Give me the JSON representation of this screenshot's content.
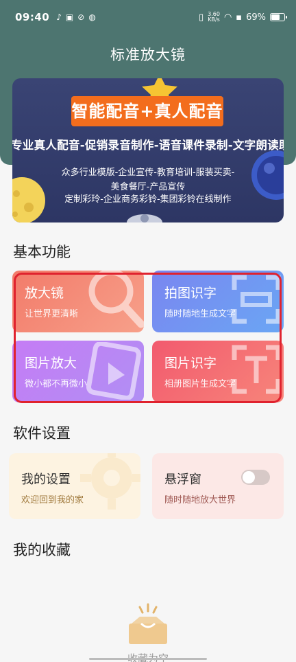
{
  "status": {
    "time": "09:40",
    "net_speed_value": "3.60",
    "net_speed_unit": "KB/s",
    "battery": "69%"
  },
  "header": {
    "title": "标准放大镜"
  },
  "banner": {
    "badge": "智能配音+真人配音",
    "line1": "专业真人配音-促销录音制作-语音课件录制-文字朗读助手",
    "line2": "众多行业模版-企业宣传-教育培训-服装买卖-",
    "line3": "美食餐厅-产品宣传",
    "line4": "定制彩玲-企业商务彩铃-集团彩铃在线制作"
  },
  "basic": {
    "title": "基本功能",
    "cards": [
      {
        "title": "放大镜",
        "subtitle": "让世界更清晰"
      },
      {
        "title": "拍图识字",
        "subtitle": "随时随地生成文字"
      },
      {
        "title": "图片放大",
        "subtitle": "微小都不再微小"
      },
      {
        "title": "图片识字",
        "subtitle": "相册图片生成文字"
      }
    ]
  },
  "settings": {
    "title": "软件设置",
    "my_settings": {
      "title": "我的设置",
      "subtitle": "欢迎回到我的家"
    },
    "floating": {
      "title": "悬浮窗",
      "subtitle": "随时随地放大世界",
      "enabled": false
    }
  },
  "favorites": {
    "title": "我的收藏",
    "empty_text": "收藏为空"
  },
  "colors": {
    "header": "#4d7570",
    "highlight": "#e0222e",
    "badge": "#f36d1d"
  }
}
